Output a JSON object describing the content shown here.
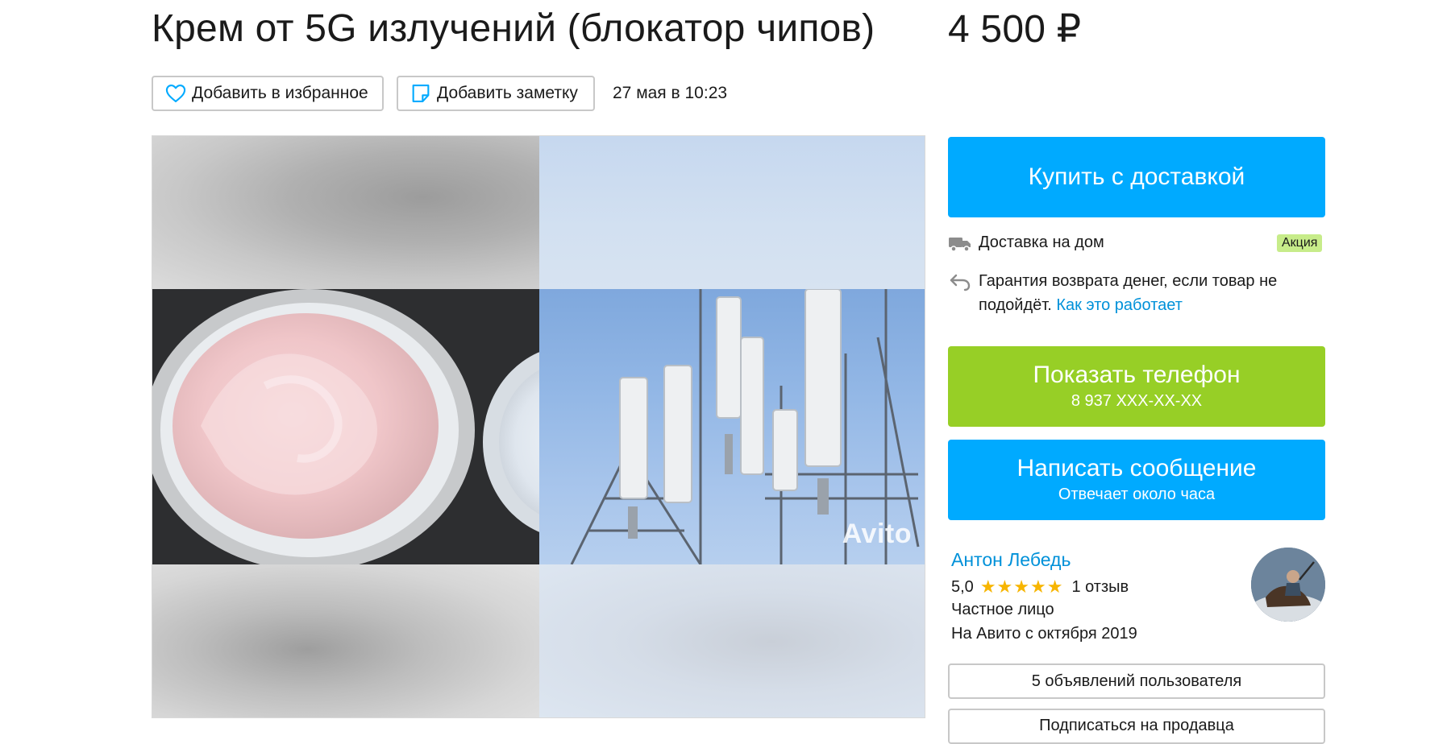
{
  "listing": {
    "title": "Крем от 5G излучений (блокатор чипов)",
    "price": "4 500 ₽",
    "date": "27 мая в 10:23"
  },
  "toolbar": {
    "favorite_label": "Добавить в избранное",
    "note_label": "Добавить заметку"
  },
  "gallery": {
    "watermark": "Avito"
  },
  "purchase": {
    "buy_label": "Купить с доставкой",
    "delivery_text": "Доставка на дом",
    "promo_badge": "Акция",
    "return_text": "Гарантия возврата денег, если товар не подойдёт.",
    "how_it_works_link": "Как это работает"
  },
  "contact": {
    "phone_label": "Показать телефон",
    "phone_masked": "8 937 XXX-XX-XX",
    "message_label": "Написать сообщение",
    "response_time": "Отвечает около часа"
  },
  "seller": {
    "name": "Антон Лебедь",
    "rating": "5,0",
    "stars": "★★★★★",
    "reviews": "1 отзыв",
    "type": "Частное лицо",
    "since": "На Авито с октября 2019",
    "listings_button": "5 объявлений пользователя",
    "subscribe_button": "Подписаться на продавца"
  },
  "colors": {
    "primary_blue": "#00aaff",
    "phone_green": "#97cf26",
    "link_blue": "#0091d9",
    "star_gold": "#f7b500",
    "promo_bg": "#c7ec8a"
  }
}
